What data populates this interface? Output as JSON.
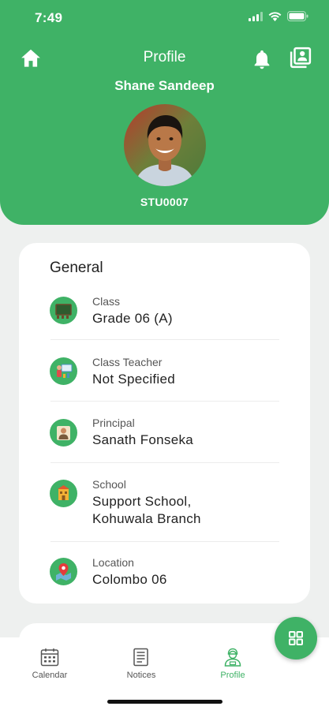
{
  "status_bar": {
    "time": "7:49"
  },
  "header": {
    "title": "Profile",
    "student_name": "Shane Sandeep",
    "student_id": "STU0007",
    "background_color": "#3fb266"
  },
  "general": {
    "title": "General",
    "items": [
      {
        "label": "Class",
        "value": "Grade 06 (A)",
        "icon": "classroom-board-icon"
      },
      {
        "label": "Class Teacher",
        "value": "Not Specified",
        "icon": "teacher-icon"
      },
      {
        "label": "Principal",
        "value": "Sanath Fonseka",
        "icon": "principal-icon"
      },
      {
        "label": "School",
        "value": "Support School,\nKohuwala Branch",
        "icon": "school-building-icon"
      },
      {
        "label": "Location",
        "value": "Colombo 06",
        "icon": "map-pin-icon"
      }
    ]
  },
  "tabs": [
    {
      "label": "Calendar",
      "icon": "calendar-icon",
      "active": false
    },
    {
      "label": "Notices",
      "icon": "notices-icon",
      "active": false
    },
    {
      "label": "Profile",
      "icon": "profile-icon",
      "active": true
    }
  ],
  "fab": {
    "icon": "grid-icon"
  }
}
